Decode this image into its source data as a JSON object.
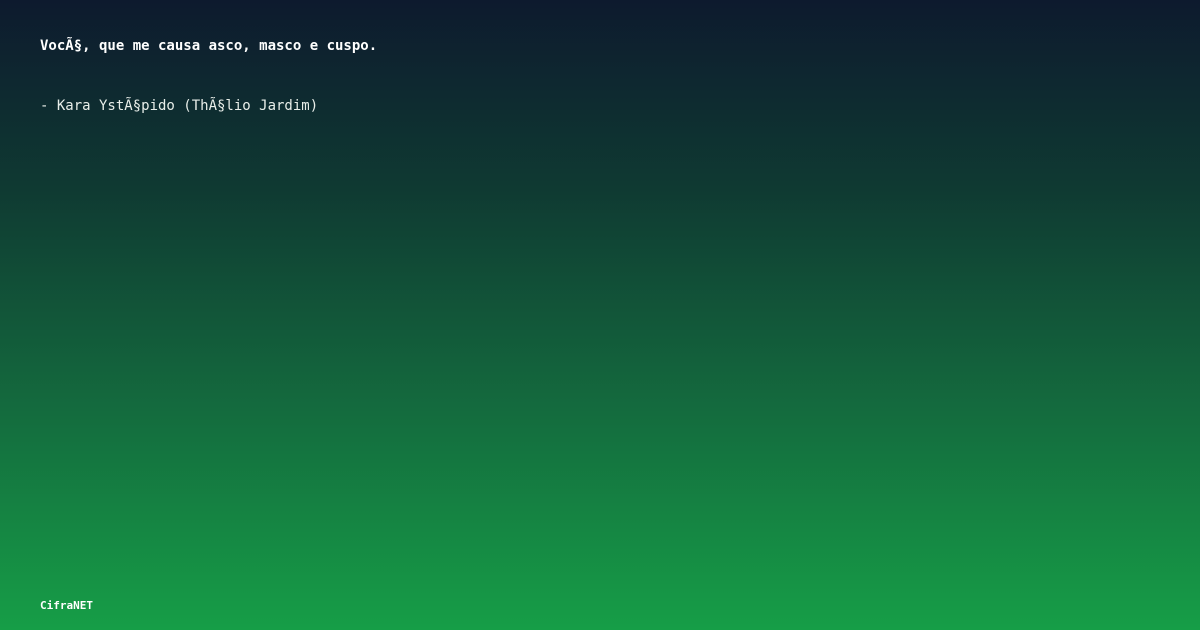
{
  "card": {
    "quote": "VocÃ§, que me causa asco, masco e cuspo.",
    "author": "- Kara YstÃ§pido (ThÃ§lio Jardim)",
    "brand": "CifraNET"
  },
  "colors": {
    "top": "#0d1a2e",
    "bottom": "#169e47",
    "text": "#ffffff"
  }
}
